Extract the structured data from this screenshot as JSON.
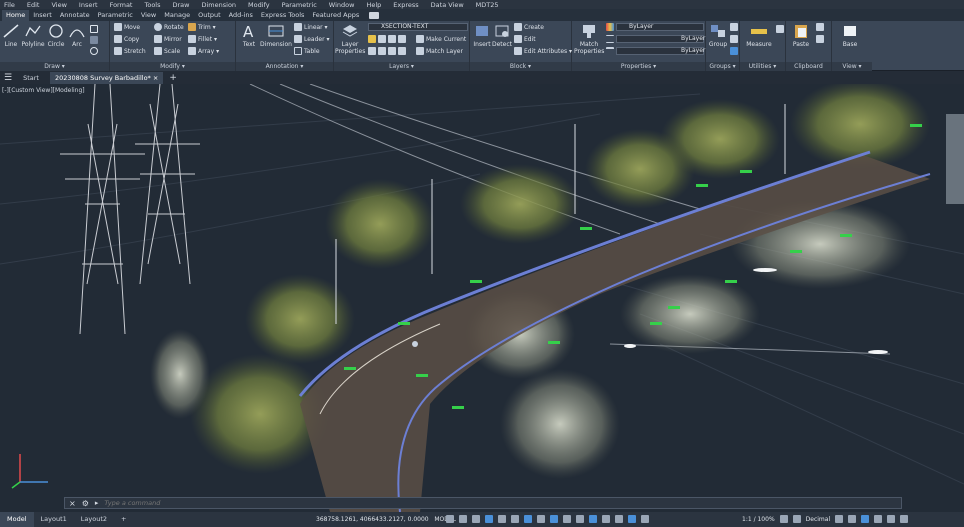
{
  "menu": [
    "File",
    "Edit",
    "View",
    "Insert",
    "Format",
    "Tools",
    "Draw",
    "Dimension",
    "Modify",
    "Parametric",
    "Window",
    "Help",
    "Express",
    "Data View",
    "MDT25"
  ],
  "ribbon_tabs": [
    "Home",
    "Insert",
    "Annotate",
    "Parametric",
    "View",
    "Manage",
    "Output",
    "Add-ins",
    "Express Tools",
    "Featured Apps"
  ],
  "active_tab": "Home",
  "panels": {
    "draw": {
      "title": "Draw ▾",
      "line": "Line",
      "polyline": "Polyline",
      "circle": "Circle",
      "arc": "Arc"
    },
    "modify": {
      "title": "Modify ▾",
      "move": "Move",
      "rotate": "Rotate",
      "trim": "Trim ▾",
      "copy": "Copy",
      "mirror": "Mirror",
      "fillet": "Fillet ▾",
      "stretch": "Stretch",
      "scale": "Scale",
      "array": "Array ▾"
    },
    "annotation": {
      "title": "Annotation ▾",
      "text": "Text",
      "dimension": "Dimension",
      "linear": "Linear ▾",
      "leader": "Leader ▾",
      "table": "Table"
    },
    "layers": {
      "title": "Layers ▾",
      "layer_properties": "Layer Properties",
      "current_layer": "XSECTION-TEXT",
      "make_current": "Make Current",
      "match_layer": "Match Layer"
    },
    "block": {
      "title": "Block ▾",
      "insert": "Insert",
      "detect": "Detect",
      "create": "Create",
      "edit": "Edit",
      "edit_attributes": "Edit Attributes ▾"
    },
    "properties": {
      "title": "Properties ▾",
      "match_properties": "Match Properties",
      "color": "ByLayer",
      "linetype": "ByLayer",
      "lineweight": "ByLayer"
    },
    "groups": {
      "title": "Groups ▾",
      "group": "Group"
    },
    "utilities": {
      "title": "Utilities ▾",
      "measure": "Measure"
    },
    "clipboard": {
      "title": "Clipboard",
      "paste": "Paste"
    },
    "view": {
      "title": "View ▾",
      "base": "Base"
    }
  },
  "file_tabs": [
    "Start",
    "20230808 Survey Barbadillo*"
  ],
  "viewport": {
    "label": "[-][Custom View][Modeling]"
  },
  "command": {
    "placeholder": "Type a command"
  },
  "layout_tabs": [
    "Model",
    "Layout1",
    "Layout2"
  ],
  "status": {
    "coordinates": "368758.1261, 4066433.2127, 0.0000",
    "mode": "MODEL",
    "scale": "1:1 / 100%",
    "units": "Decimal"
  },
  "colors": {
    "accent": "#4a90d9",
    "ribbon": "#3b4757",
    "viewport": "#222b36",
    "road_edge": "#6c7fd4"
  }
}
